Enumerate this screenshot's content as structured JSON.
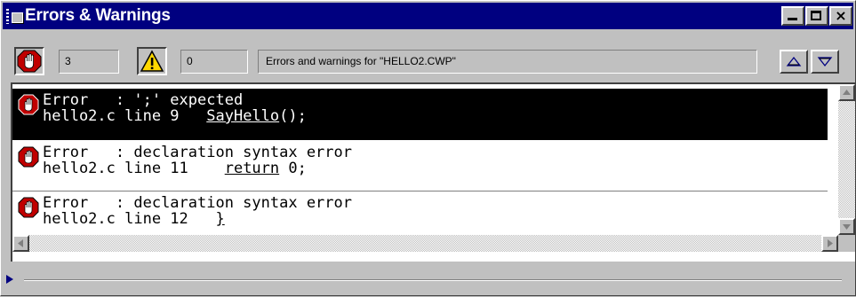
{
  "window": {
    "title": "Errors & Warnings",
    "buttons": {
      "minimize": "minimize",
      "maximize": "maximize",
      "close": "×"
    }
  },
  "toolbar": {
    "error_count": "3",
    "warning_count": "0",
    "status_text": "Errors and warnings for \"HELLO2.CWP\""
  },
  "messages": [
    {
      "type": "Error",
      "l1_prefix": "Error   : ",
      "l1_text": "';' expected",
      "file": "hello2.c line 9",
      "code_pre": "",
      "code_u": "SayHello",
      "code_post": "();",
      "selected": true
    },
    {
      "type": "Error",
      "l1_prefix": "Error   : ",
      "l1_text": "declaration syntax error",
      "file": "hello2.c line 11",
      "code_pre": "",
      "code_u": "return",
      "code_post": " 0;",
      "selected": false
    },
    {
      "type": "Error",
      "l1_prefix": "Error   : ",
      "l1_text": "declaration syntax error",
      "file": "hello2.c line 12",
      "code_pre": "",
      "code_u": "}",
      "code_post": "",
      "selected": false
    }
  ],
  "colors": {
    "titlebar": "#000080",
    "stop_red": "#c00000",
    "warning_yellow": "#ffd800"
  },
  "icons": {
    "error": "stop-hand-icon",
    "warning": "warning-triangle-icon"
  }
}
